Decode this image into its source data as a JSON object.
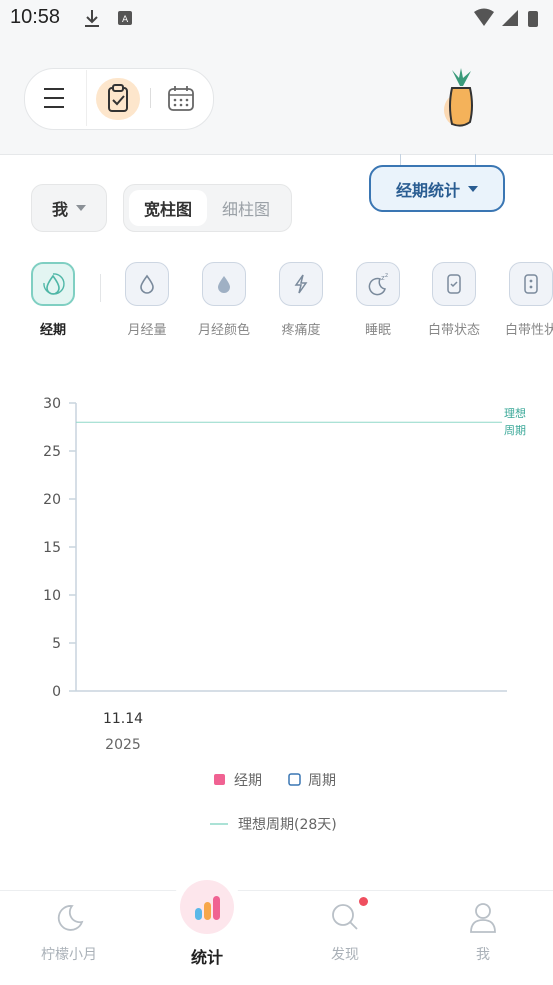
{
  "status_bar": {
    "time": "10:58"
  },
  "header": {
    "menu_icon": "menu-icon",
    "todo_icon": "clipboard-check-icon",
    "calendar_icon": "calendar-icon",
    "logo_icon": "lemon-pineapple-logo"
  },
  "controls": {
    "period_stats_label": "经期统计",
    "me_label": "我",
    "wide_bar_label": "宽柱图",
    "thin_bar_label": "细柱图"
  },
  "categories": [
    {
      "label": "经期",
      "icon": "droplet-cycle-icon",
      "active": true
    },
    {
      "label": "月经量",
      "icon": "droplet-outline-icon",
      "active": false
    },
    {
      "label": "月经颜色",
      "icon": "droplet-filled-icon",
      "active": false
    },
    {
      "label": "疼痛度",
      "icon": "lightning-icon",
      "active": false
    },
    {
      "label": "睡眠",
      "icon": "moon-zz-icon",
      "active": false
    },
    {
      "label": "白带状态",
      "icon": "card-check-icon",
      "active": false
    },
    {
      "label": "白带性状",
      "icon": "card-dots-icon",
      "active": false
    }
  ],
  "chart_data": {
    "type": "bar",
    "categories": [
      "11.14\n2025"
    ],
    "x_tick_day": "11.14",
    "x_tick_year": "2025",
    "ylim": [
      0,
      30
    ],
    "yticks": [
      0,
      5,
      10,
      15,
      20,
      25,
      30
    ],
    "series": [
      {
        "name": "经期",
        "color": "#f06292",
        "values": [
          0
        ]
      },
      {
        "name": "周期",
        "color": "#3a76b3",
        "values": [
          0
        ]
      }
    ],
    "reference_line": {
      "value": 28,
      "label_line1": "理想",
      "label_line2": "周期",
      "legend": "理想周期(28天)",
      "color": "#8fd8c8"
    },
    "legend_position": "bottom"
  },
  "bottom_nav": [
    {
      "label": "柠檬小月",
      "icon": "moon-icon",
      "active": false
    },
    {
      "label": "统计",
      "icon": "bar-chart-icon",
      "active": true
    },
    {
      "label": "发现",
      "icon": "search-icon",
      "active": false,
      "badge": true
    },
    {
      "label": "我",
      "icon": "user-icon",
      "active": false
    }
  ],
  "colors": {
    "accent": "#3a76b3",
    "teal": "#5cc4b3",
    "pink": "#f06292",
    "orange": "#f7a74a"
  }
}
